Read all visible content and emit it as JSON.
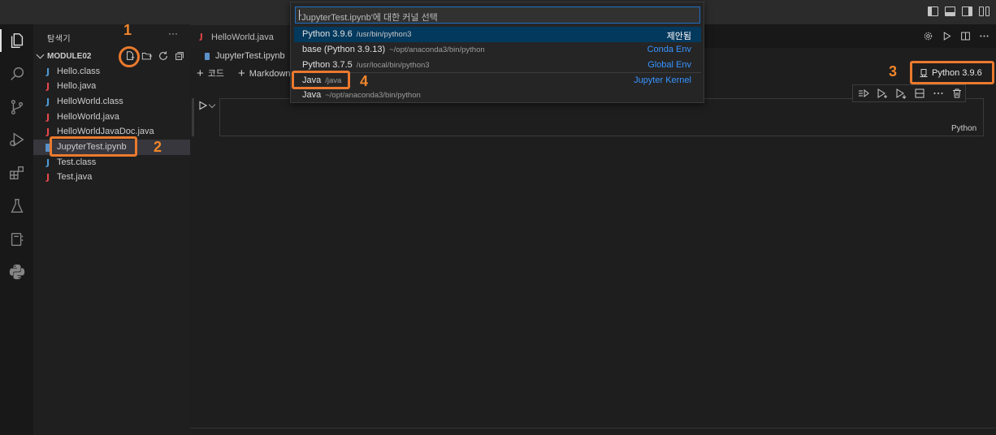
{
  "explorer": {
    "title": "탐색기",
    "more": "···",
    "folder": "MODULE02",
    "files": [
      {
        "icon": "J",
        "color": "blue",
        "name": "Hello.class"
      },
      {
        "icon": "J",
        "color": "red",
        "name": "Hello.java"
      },
      {
        "icon": "J",
        "color": "blue",
        "name": "HelloWorld.class"
      },
      {
        "icon": "J",
        "color": "red",
        "name": "HelloWorld.java"
      },
      {
        "icon": "J",
        "color": "red",
        "name": "HelloWorldJavaDoc.java"
      },
      {
        "icon": "notebook",
        "color": "blue",
        "name": "JupyterTest.ipynb"
      },
      {
        "icon": "J",
        "color": "blue",
        "name": "Test.class"
      },
      {
        "icon": "J",
        "color": "red",
        "name": "Test.java"
      }
    ]
  },
  "tabs": [
    {
      "icon": "J",
      "label": "HelloWorld.java"
    }
  ],
  "breadcrumb": {
    "file": "JupyterTest.ipynb"
  },
  "notebook_toolbar": {
    "code": "코드",
    "markdown": "Markdown"
  },
  "kernel_button": {
    "label": "Python 3.9.6"
  },
  "cell": {
    "language": "Python"
  },
  "quick_pick": {
    "placeholder": "'JupyterTest.ipynb'에 대한 커널 선택",
    "items": [
      {
        "name": "Python 3.9.6",
        "path": "/usr/bin/python3",
        "tag": "제안됨",
        "active": true
      },
      {
        "name": "base (Python 3.9.13)",
        "path": "~/opt/anaconda3/bin/python",
        "tag": "Conda Env"
      },
      {
        "name": "Python 3.7.5",
        "path": "/usr/local/bin/python3",
        "tag": "Global Env"
      },
      {
        "name": "Java",
        "path": "/java",
        "tag": "Jupyter Kernel"
      },
      {
        "name": "Java",
        "path": "~/opt/anaconda3/bin/python",
        "tag": ""
      }
    ]
  },
  "annotations": [
    "1",
    "2",
    "3",
    "4"
  ],
  "colors": {
    "accent": "#ea7a2e",
    "selection": "#04395e",
    "link": "#3794ff",
    "java_red": "#e8474a",
    "java_blue": "#4f9cd8"
  }
}
